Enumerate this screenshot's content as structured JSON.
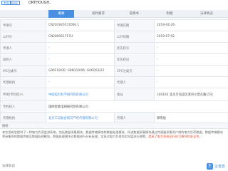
{
  "header": {
    "tag1": "专利",
    "tag2": "授权",
    "title": "ORTHOUGH.."
  },
  "tabs": [
    {
      "label": "概要",
      "active": true
    },
    {
      "label": "权利要求",
      "active": false
    },
    {
      "label": "说明书",
      "active": false
    },
    {
      "label": "附图",
      "active": false
    },
    {
      "label": "法律状态",
      "active": false
    }
  ],
  "info_rows": [
    [
      "申请号",
      "CN201920572006.1",
      "申请日期",
      "2019-04-26"
    ],
    [
      "公开号",
      "CN209061717U",
      "公开日期",
      "2019-07-02"
    ],
    [
      "申请人",
      "-",
      "优先权号",
      "-"
    ],
    [
      "发明人",
      "-",
      "优先权日",
      "-"
    ],
    [
      "IPC分类号",
      "G06F19/00; G06Q10/06; G06Q50/22",
      "CPC分类号",
      "-"
    ],
    [
      "代理机构",
      "-",
      "代理人",
      "-"
    ],
    [
      "申请(专利权)人",
      "中国电力科学研究院有限公司",
      "地址",
      "100192 北京市海淀区清河小营东路15号"
    ],
    [
      "专利权人",
      "国网智能电网研究院有限公司",
      "",
      ""
    ],
    [
      "代理机构",
      "北京工信联合知识产权代理有限公司",
      "代理人",
      "郭晓丽"
    ]
  ],
  "abstract": {
    "label": "摘要",
    "text": "本实用新型提供了一种电力负荷监测系统，包括数据采集模块、数据传输模块和数据处理模块，所述数据采集模块通过传感器采集用户侧的电力负荷数据，数据传输模块将采集到的数据传输至数据处理模块，数据处理模块对数据进行分析处理，实现对电力负荷的实时监测与预警，",
    "highlight": "提高了电力系统运行的可靠性和安全性。"
  },
  "footer": {
    "label": "法律状态",
    "logo_mark": "企",
    "logo_text": "企查查"
  },
  "colors": {
    "accent": "#4a90e2",
    "highlight": "#e0533a"
  }
}
